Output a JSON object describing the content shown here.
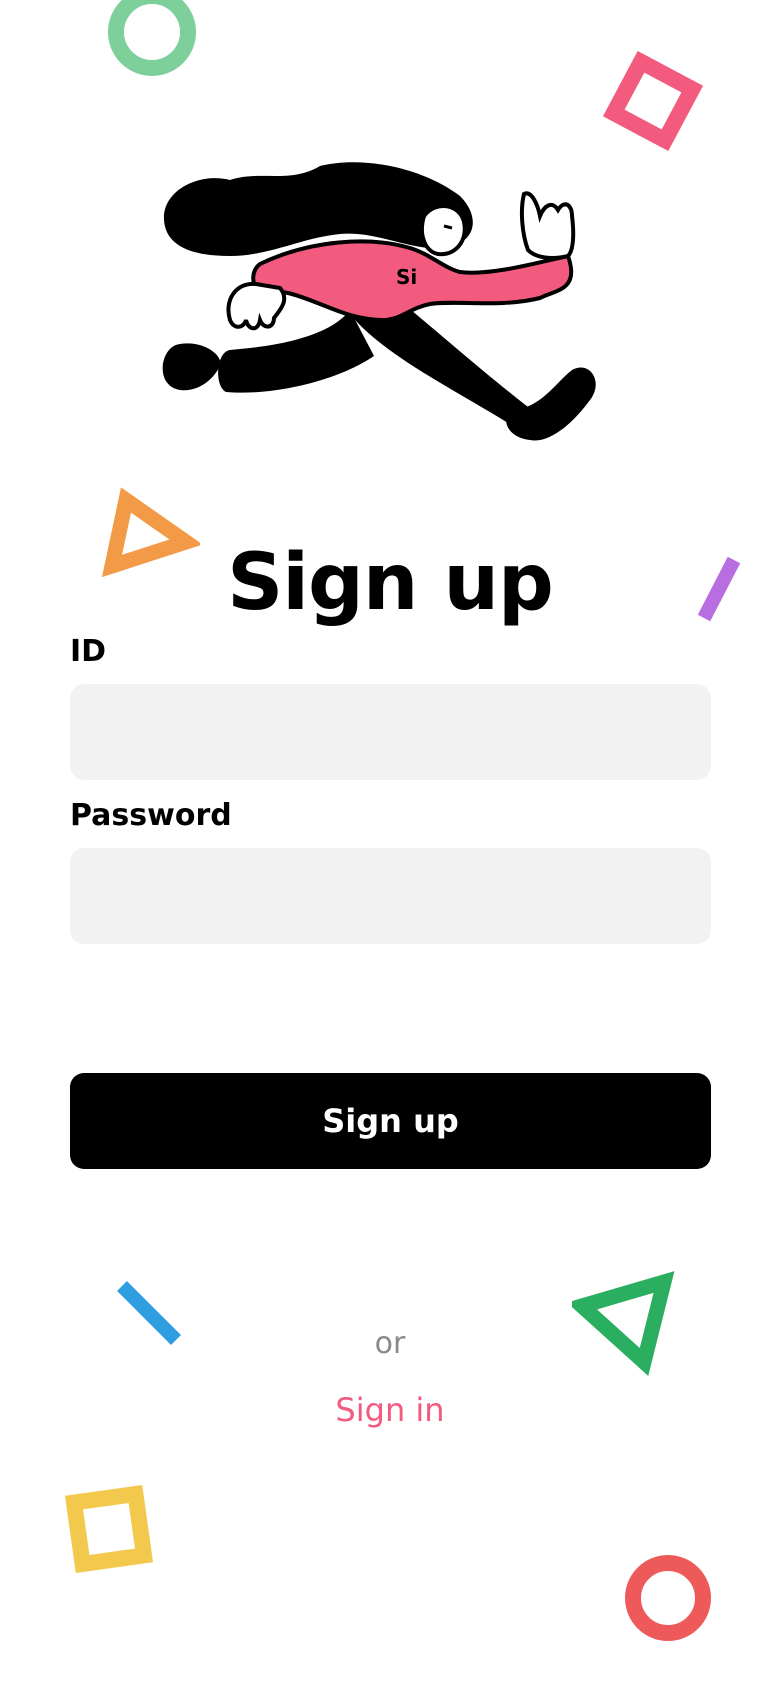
{
  "header": {
    "title": "Sign up"
  },
  "illustration": {
    "icon": "running-person-illustration",
    "shirt_text": "Si"
  },
  "form": {
    "id_label": "ID",
    "id_value": "",
    "password_label": "Password",
    "password_value": "",
    "submit_label": "Sign up"
  },
  "footer": {
    "or_text": "or",
    "signin_link": "Sign in"
  },
  "colors": {
    "accent": "#f25a7e",
    "button": "#000000",
    "input_bg": "#f2f2f2",
    "deco_green_ring": "#7dd09a",
    "deco_pink_square": "#f25a7e",
    "deco_orange_triangle": "#f29a45",
    "deco_purple_bar": "#b86ee0",
    "deco_blue_bar": "#2f9ee0",
    "deco_green_triangle": "#2aae5f",
    "deco_yellow_square": "#f2c94c",
    "deco_red_ring": "#ee5a5a"
  }
}
